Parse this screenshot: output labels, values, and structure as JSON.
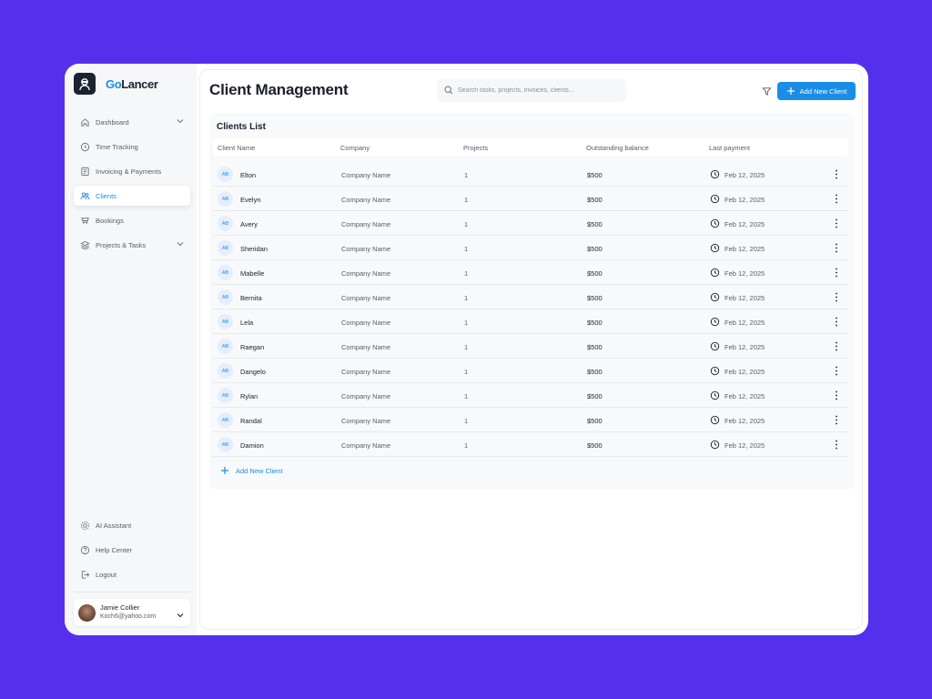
{
  "app": {
    "logo_go": "Go",
    "logo_lancer": "Lancer"
  },
  "colors": {
    "background": "#5530ec",
    "accent": "#1a8de6",
    "sidebar": "#f6f7f8"
  },
  "sidebar": {
    "items": [
      {
        "label": "Dashboard",
        "icon": "home-icon",
        "has_chevron": true,
        "active": false
      },
      {
        "label": "Time Tracking",
        "icon": "clock-icon",
        "has_chevron": false,
        "active": false
      },
      {
        "label": "Invoicing & Payments",
        "icon": "invoice-icon",
        "has_chevron": false,
        "active": false
      },
      {
        "label": "Clients",
        "icon": "clients-icon",
        "has_chevron": false,
        "active": true
      },
      {
        "label": "Bookings",
        "icon": "bookings-icon",
        "has_chevron": false,
        "active": false
      },
      {
        "label": "Projects & Tasks",
        "icon": "layers-icon",
        "has_chevron": true,
        "active": false
      }
    ],
    "bottom_items": [
      {
        "label": "AI Assistant",
        "icon": "ai-icon"
      },
      {
        "label": "Help Center",
        "icon": "help-icon"
      },
      {
        "label": "Logout",
        "icon": "logout-icon"
      }
    ],
    "user": {
      "name": "Jamie Collier",
      "email": "Koch6@yahoo.com"
    }
  },
  "header": {
    "title": "Client Management",
    "search_placeholder": "Search tasks, projects, invoices, clients...",
    "add_button": "Add New Client"
  },
  "clients_list": {
    "title": "Clients List",
    "columns": [
      "Client Name",
      "Company",
      "Projects",
      "Outstanding balance",
      "Last payment"
    ],
    "rows": [
      {
        "initials": "AB",
        "name": "Elton",
        "company": "Company Name",
        "projects": "1",
        "balance": "$500",
        "last_payment": "Feb 12, 2025"
      },
      {
        "initials": "AB",
        "name": "Evelyn",
        "company": "Company Name",
        "projects": "1",
        "balance": "$500",
        "last_payment": "Feb 12, 2025"
      },
      {
        "initials": "AB",
        "name": "Avery",
        "company": "Company Name",
        "projects": "1",
        "balance": "$500",
        "last_payment": "Feb 12, 2025"
      },
      {
        "initials": "AB",
        "name": "Sheridan",
        "company": "Company Name",
        "projects": "1",
        "balance": "$500",
        "last_payment": "Feb 12, 2025"
      },
      {
        "initials": "AB",
        "name": "Mabelle",
        "company": "Company Name",
        "projects": "1",
        "balance": "$500",
        "last_payment": "Feb 12, 2025"
      },
      {
        "initials": "AB",
        "name": "Bernita",
        "company": "Company Name",
        "projects": "1",
        "balance": "$500",
        "last_payment": "Feb 12, 2025"
      },
      {
        "initials": "AB",
        "name": "Lela",
        "company": "Company Name",
        "projects": "1",
        "balance": "$500",
        "last_payment": "Feb 12, 2025"
      },
      {
        "initials": "AB",
        "name": "Raegan",
        "company": "Company Name",
        "projects": "1",
        "balance": "$500",
        "last_payment": "Feb 12, 2025"
      },
      {
        "initials": "AB",
        "name": "Dangelo",
        "company": "Company Name",
        "projects": "1",
        "balance": "$500",
        "last_payment": "Feb 12, 2025"
      },
      {
        "initials": "AB",
        "name": "Rylan",
        "company": "Company Name",
        "projects": "1",
        "balance": "$500",
        "last_payment": "Feb 12, 2025"
      },
      {
        "initials": "AB",
        "name": "Randal",
        "company": "Company Name",
        "projects": "1",
        "balance": "$500",
        "last_payment": "Feb 12, 2025"
      },
      {
        "initials": "AB",
        "name": "Damion",
        "company": "Company Name",
        "projects": "1",
        "balance": "$500",
        "last_payment": "Feb 12, 2025"
      }
    ],
    "add_label": "Add New Client"
  }
}
